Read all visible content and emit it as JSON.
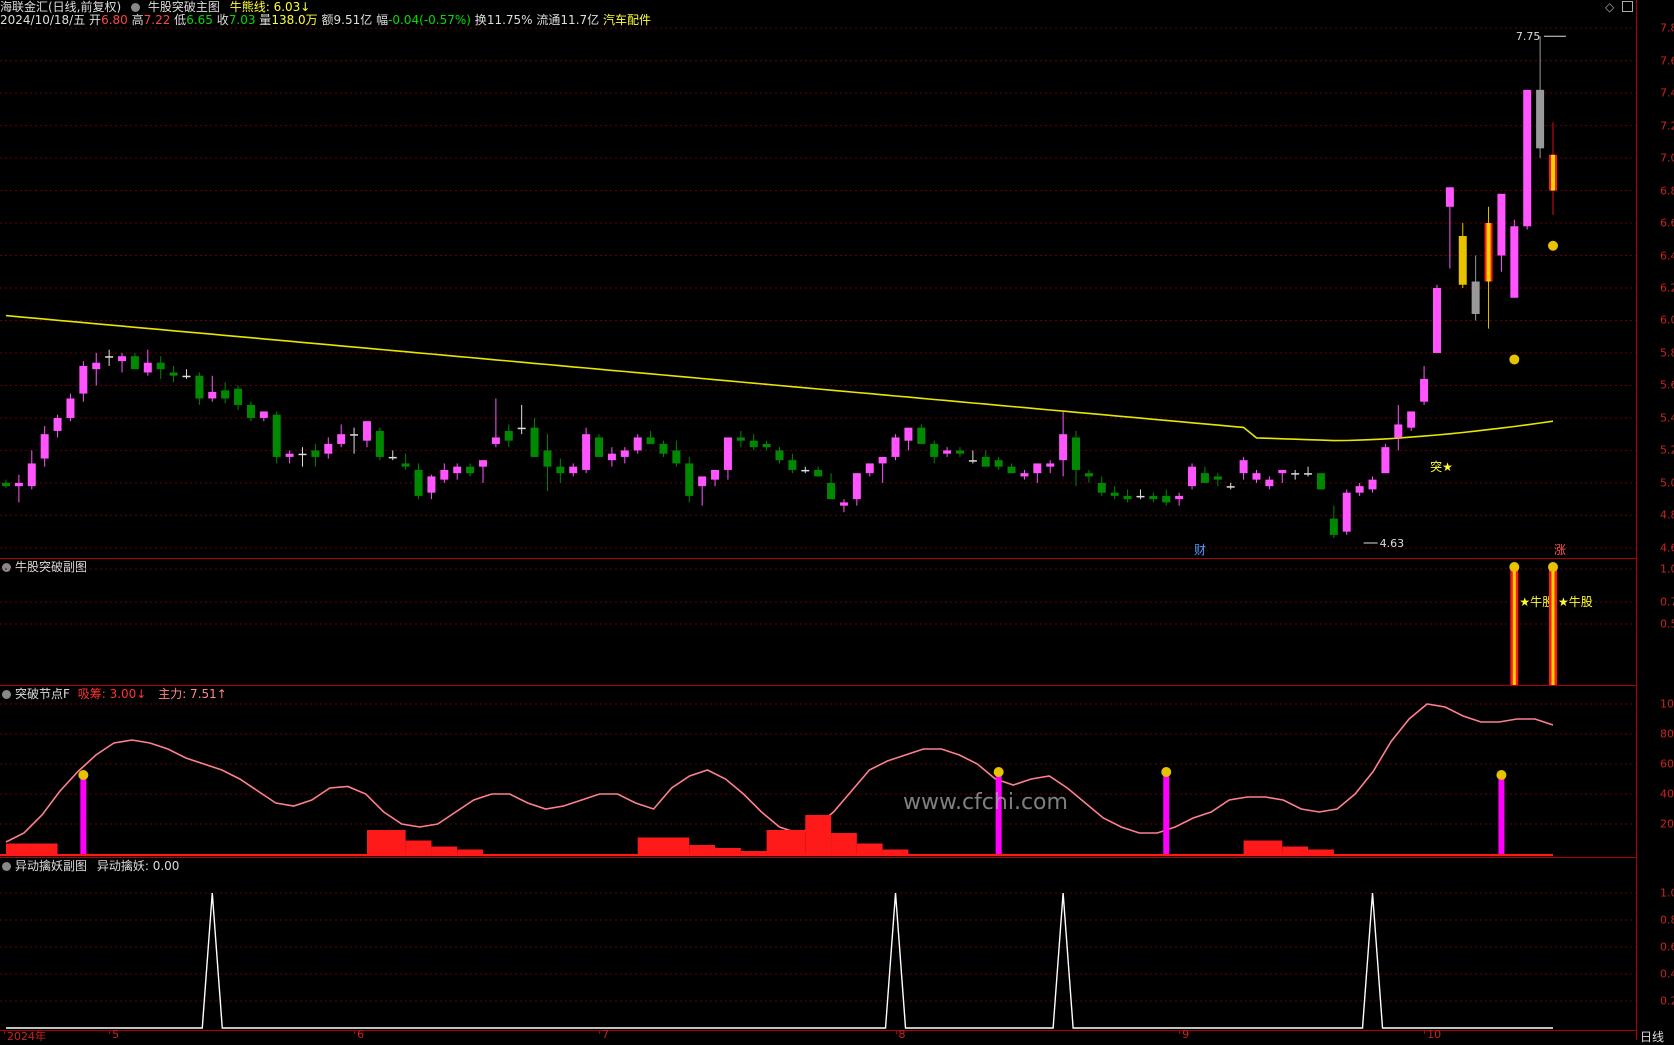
{
  "header": {
    "app_name": "海联金汇(日线,前复权)",
    "indicator_name": "牛股突破主图",
    "line_label": "牛熊线:",
    "line_value": "6.03↓",
    "date": "2024/10/18/五",
    "open_label": "开",
    "open": "6.80",
    "high_label": "高",
    "high": "7.22",
    "low_label": "低",
    "low": "6.65",
    "close_label": "收",
    "close": "7.03",
    "vol_label": "量",
    "vol": "138.0万",
    "amount_label": "额",
    "amount": "9.51亿",
    "change_label": "幅",
    "change": "-0.04(-0.57%)",
    "turnover_label": "换",
    "turnover": "11.75%",
    "float_label": "流通",
    "float": "11.7亿",
    "sector": "汽车配件"
  },
  "main_panel": {
    "yticks": [
      "7.8",
      "7.6",
      "7.4",
      "7.2",
      "7.0",
      "6.8",
      "6.6",
      "6.4",
      "6.2",
      "6.0",
      "5.8",
      "5.6",
      "5.4",
      "5.2",
      "5.0",
      "4.8",
      "4.6"
    ],
    "high_marker": "7.75",
    "low_marker": "4.63",
    "break_label": "突★",
    "cai_label": "财",
    "zhang_label": "涨"
  },
  "panel2": {
    "title": "牛股突破副图",
    "yticks": [
      "1.0",
      "0.7",
      "0.5"
    ],
    "signal_label": "★牛股"
  },
  "panel3": {
    "title": "突破节点F",
    "retail_label": "吸筹: 3.00↓",
    "main_label": "主力: 7.51↑",
    "yticks": [
      "100.0",
      "80.0",
      "60.0",
      "40.0",
      "20.0"
    ]
  },
  "panel4": {
    "title": "异动擒妖副图",
    "value_label": "异动擒妖: 0.00",
    "yticks": [
      "1.0",
      "0.8",
      "0.6",
      "0.4",
      "0.2"
    ]
  },
  "xaxis": {
    "labels": [
      "2024年",
      "5",
      "6",
      "7",
      "8",
      "9",
      "10"
    ],
    "corner_label": "日线"
  },
  "watermark": "www.cfchi.com",
  "colors": {
    "up": "#ff55ff",
    "down": "#008800",
    "neutral": "#999999",
    "ma": "#e6e600",
    "grid": "#6a0000",
    "axis_text": "#cc2222",
    "pink_line": "#ff7f8f"
  },
  "chart_data": {
    "type": "candlestick",
    "series": [
      {
        "ohlc": [
          [
            5.0,
            5.02,
            4.97,
            4.98
          ],
          [
            4.98,
            5.05,
            4.88,
            5.0
          ],
          [
            4.98,
            5.2,
            4.96,
            5.12
          ],
          [
            5.15,
            5.35,
            5.1,
            5.3
          ],
          [
            5.32,
            5.42,
            5.28,
            5.4
          ],
          [
            5.4,
            5.55,
            5.38,
            5.52
          ],
          [
            5.55,
            5.75,
            5.5,
            5.72
          ],
          [
            5.7,
            5.8,
            5.6,
            5.74
          ],
          [
            5.78,
            5.82,
            5.72,
            5.78
          ],
          [
            5.75,
            5.8,
            5.68,
            5.78
          ],
          [
            5.78,
            5.8,
            5.7,
            5.7
          ],
          [
            5.68,
            5.82,
            5.66,
            5.74
          ],
          [
            5.74,
            5.78,
            5.64,
            5.7
          ],
          [
            5.68,
            5.72,
            5.62,
            5.66
          ],
          [
            5.66,
            5.7,
            5.64,
            5.66
          ],
          [
            5.66,
            5.68,
            5.48,
            5.52
          ],
          [
            5.52,
            5.66,
            5.5,
            5.56
          ],
          [
            5.57,
            5.62,
            5.49,
            5.52
          ],
          [
            5.58,
            5.6,
            5.45,
            5.48
          ],
          [
            5.48,
            5.5,
            5.38,
            5.4
          ],
          [
            5.4,
            5.44,
            5.38,
            5.44
          ],
          [
            5.42,
            5.44,
            5.12,
            5.16
          ],
          [
            5.16,
            5.2,
            5.12,
            5.18
          ],
          [
            5.18,
            5.22,
            5.1,
            5.18
          ],
          [
            5.2,
            5.24,
            5.1,
            5.16
          ],
          [
            5.18,
            5.28,
            5.15,
            5.24
          ],
          [
            5.24,
            5.36,
            5.22,
            5.3
          ],
          [
            5.3,
            5.34,
            5.18,
            5.3
          ],
          [
            5.26,
            5.38,
            5.22,
            5.38
          ],
          [
            5.32,
            5.34,
            5.14,
            5.16
          ],
          [
            5.16,
            5.2,
            5.14,
            5.16
          ],
          [
            5.12,
            5.18,
            5.08,
            5.1
          ],
          [
            5.08,
            5.12,
            4.9,
            4.92
          ],
          [
            4.94,
            5.05,
            4.9,
            5.04
          ],
          [
            5.02,
            5.12,
            5.0,
            5.08
          ],
          [
            5.06,
            5.12,
            5.02,
            5.1
          ],
          [
            5.1,
            5.12,
            5.04,
            5.06
          ],
          [
            5.1,
            5.14,
            5.0,
            5.14
          ],
          [
            5.24,
            5.52,
            5.22,
            5.28
          ],
          [
            5.32,
            5.36,
            5.22,
            5.26
          ],
          [
            5.34,
            5.48,
            5.3,
            5.34
          ],
          [
            5.34,
            5.4,
            5.16,
            5.16
          ],
          [
            5.2,
            5.3,
            4.95,
            5.1
          ],
          [
            5.1,
            5.15,
            5.0,
            5.06
          ],
          [
            5.06,
            5.12,
            5.04,
            5.1
          ],
          [
            5.08,
            5.34,
            5.06,
            5.3
          ],
          [
            5.28,
            5.3,
            5.16,
            5.16
          ],
          [
            5.14,
            5.22,
            5.1,
            5.18
          ],
          [
            5.16,
            5.22,
            5.12,
            5.2
          ],
          [
            5.2,
            5.3,
            5.18,
            5.28
          ],
          [
            5.28,
            5.32,
            5.24,
            5.24
          ],
          [
            5.24,
            5.26,
            5.16,
            5.18
          ],
          [
            5.2,
            5.26,
            5.1,
            5.12
          ],
          [
            5.12,
            5.16,
            4.88,
            4.92
          ],
          [
            4.98,
            5.02,
            4.86,
            5.04
          ],
          [
            5.02,
            5.08,
            4.98,
            5.08
          ],
          [
            5.08,
            5.14,
            5.02,
            5.28
          ],
          [
            5.28,
            5.32,
            5.22,
            5.26
          ],
          [
            5.26,
            5.3,
            5.2,
            5.22
          ],
          [
            5.24,
            5.26,
            5.2,
            5.22
          ],
          [
            5.2,
            5.22,
            5.12,
            5.14
          ],
          [
            5.14,
            5.18,
            5.06,
            5.08
          ],
          [
            5.08,
            5.1,
            5.06,
            5.08
          ],
          [
            5.08,
            5.1,
            5.04,
            5.04
          ],
          [
            5.0,
            5.06,
            4.9,
            4.9
          ],
          [
            4.86,
            4.9,
            4.82,
            4.88
          ],
          [
            4.9,
            5.06,
            4.86,
            5.06
          ],
          [
            5.06,
            5.12,
            5.04,
            5.12
          ],
          [
            5.12,
            5.16,
            5.0,
            5.16
          ],
          [
            5.16,
            5.3,
            5.14,
            5.28
          ],
          [
            5.26,
            5.32,
            5.2,
            5.34
          ],
          [
            5.34,
            5.36,
            5.24,
            5.24
          ],
          [
            5.24,
            5.26,
            5.12,
            5.16
          ],
          [
            5.18,
            5.22,
            5.16,
            5.2
          ],
          [
            5.2,
            5.22,
            5.16,
            5.18
          ],
          [
            5.14,
            5.2,
            5.12,
            5.14
          ],
          [
            5.16,
            5.2,
            5.12,
            5.1
          ],
          [
            5.14,
            5.16,
            5.08,
            5.1
          ],
          [
            5.1,
            5.12,
            5.06,
            5.06
          ],
          [
            5.04,
            5.08,
            5.02,
            5.06
          ],
          [
            5.06,
            5.1,
            5.0,
            5.12
          ],
          [
            5.1,
            5.14,
            5.06,
            5.12
          ],
          [
            5.14,
            5.44,
            5.04,
            5.3
          ],
          [
            5.28,
            5.32,
            4.98,
            5.08
          ],
          [
            5.06,
            5.08,
            5.0,
            5.04
          ],
          [
            5.0,
            5.04,
            4.92,
            4.94
          ],
          [
            4.94,
            4.98,
            4.9,
            4.92
          ],
          [
            4.92,
            4.96,
            4.88,
            4.9
          ],
          [
            4.92,
            4.96,
            4.9,
            4.92
          ],
          [
            4.92,
            4.94,
            4.88,
            4.9
          ],
          [
            4.92,
            4.96,
            4.86,
            4.88
          ],
          [
            4.9,
            4.94,
            4.86,
            4.92
          ],
          [
            4.98,
            5.12,
            4.96,
            5.1
          ],
          [
            5.06,
            5.1,
            5.0,
            5.0
          ],
          [
            5.04,
            5.06,
            4.98,
            5.02
          ],
          [
            4.98,
            5.0,
            4.96,
            4.98
          ],
          [
            5.06,
            5.16,
            5.02,
            5.14
          ],
          [
            5.02,
            5.08,
            5.0,
            5.06
          ],
          [
            4.98,
            5.04,
            4.96,
            5.02
          ],
          [
            5.06,
            5.08,
            5.0,
            5.08
          ],
          [
            5.06,
            5.08,
            5.02,
            5.06
          ],
          [
            5.06,
            5.1,
            5.04,
            5.06
          ],
          [
            5.06,
            5.02,
            4.96,
            4.96
          ],
          [
            4.78,
            4.86,
            4.66,
            4.68
          ],
          [
            4.7,
            4.96,
            4.68,
            4.94
          ],
          [
            4.94,
            5.0,
            4.92,
            4.98
          ],
          [
            4.96,
            5.04,
            4.94,
            5.02
          ],
          [
            5.06,
            5.24,
            5.06,
            5.22
          ],
          [
            5.28,
            5.48,
            5.2,
            5.36
          ],
          [
            5.34,
            5.4,
            5.32,
            5.44
          ],
          [
            5.5,
            5.72,
            5.48,
            5.64
          ],
          [
            5.8,
            6.22,
            5.8,
            6.2
          ],
          [
            6.7,
            6.82,
            6.32,
            6.82
          ],
          [
            6.52,
            6.6,
            6.2,
            6.22
          ],
          [
            6.24,
            6.4,
            6.0,
            6.04
          ],
          [
            6.24,
            6.7,
            5.95,
            6.6
          ],
          [
            6.4,
            6.74,
            6.3,
            6.78
          ],
          [
            6.14,
            6.62,
            6.14,
            6.58
          ],
          [
            6.58,
            7.42,
            6.56,
            7.42
          ],
          [
            7.42,
            7.75,
            7.0,
            7.06
          ],
          [
            7.02,
            7.22,
            6.65,
            6.8
          ]
        ]
      }
    ],
    "ma_line": {
      "start": 6.03,
      "end": 5.38,
      "min": 5.26
    },
    "ylim": [
      4.55,
      7.85
    ]
  }
}
